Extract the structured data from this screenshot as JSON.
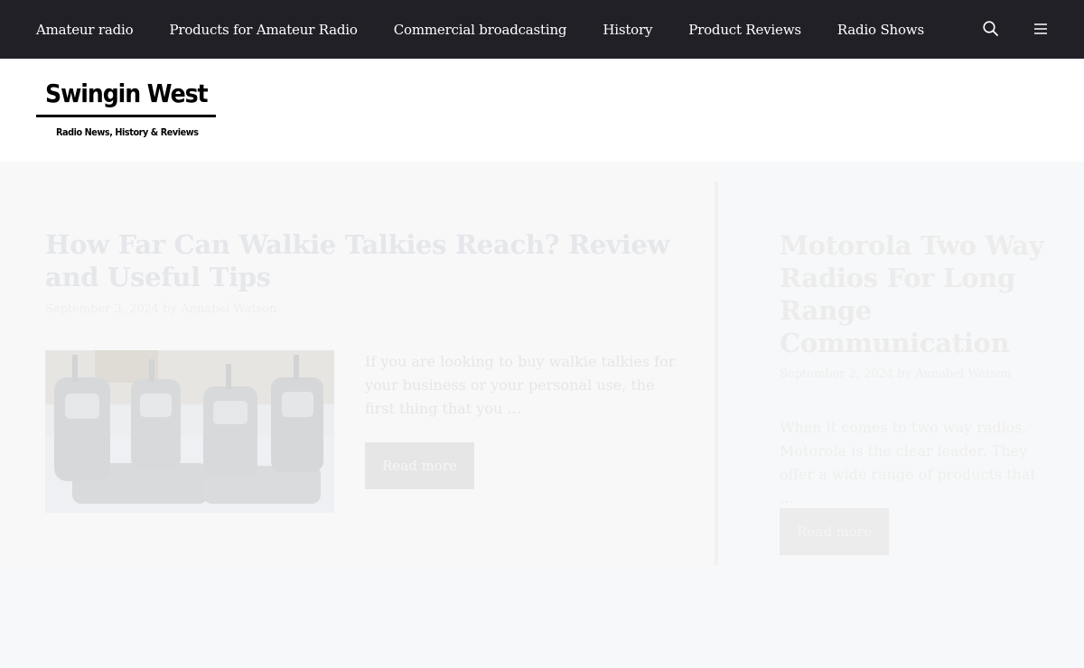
{
  "nav": {
    "items": [
      {
        "label": "Amateur radio"
      },
      {
        "label": "Products for Amateur Radio"
      },
      {
        "label": "Commercial broadcasting"
      },
      {
        "label": "History"
      },
      {
        "label": "Product Reviews"
      },
      {
        "label": "Radio Shows"
      }
    ],
    "icons": [
      "search-icon",
      "menu-icon"
    ]
  },
  "header": {
    "logo_title": "Swingin West",
    "logo_subtitle": "Radio News, History & Reviews"
  },
  "posts": [
    {
      "title": "How Far Can Walkie Talkies Reach? Review and Useful Tips",
      "meta": "September 3, 2024 by Annabel Watson",
      "excerpt": "If you are looking to buy walkie talkies for your business or your personal use, the first thing that you …",
      "read_more": "Read more",
      "thumbnail": "walkie-talkies-image"
    },
    {
      "title": "Motorola Two Way Radios For Long Range Communication",
      "meta": "September 2, 2024 by Annabel Watson",
      "excerpt": "When it comes to two way radios, Motorola is the clear leader. They offer a wide range of products that …",
      "read_more": "Read more"
    }
  ],
  "colors": {
    "nav_bg": "#222027",
    "page_bg": "#f7f8f9",
    "faded_title": "#e5e7eb"
  }
}
